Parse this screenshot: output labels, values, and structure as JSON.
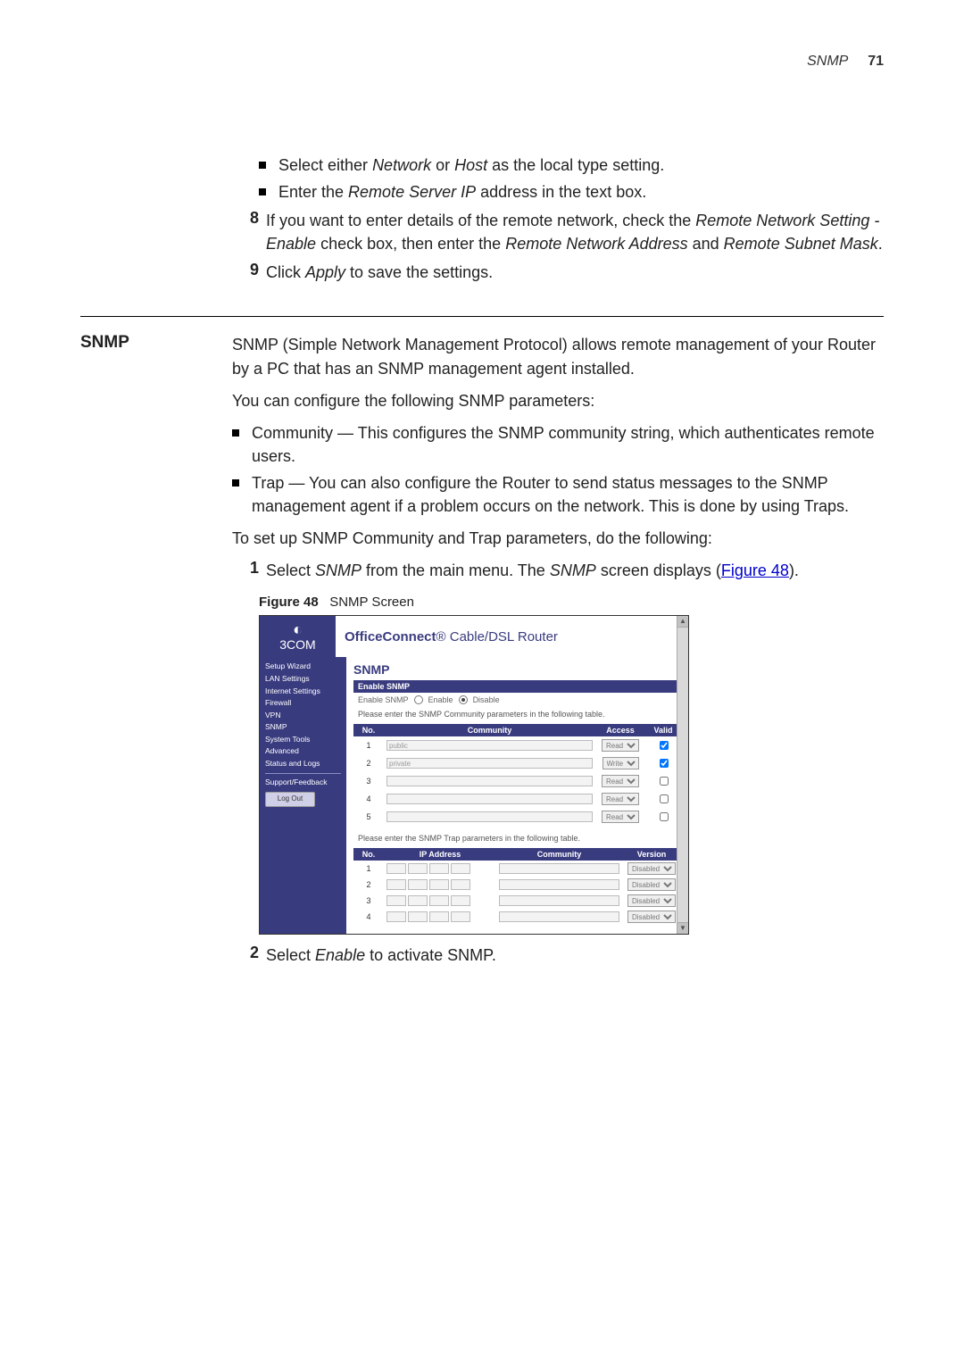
{
  "header": {
    "section": "SNMP",
    "page": "71"
  },
  "top_bullets": [
    {
      "pre": "Select either ",
      "i1": "Network",
      "mid": " or ",
      "i2": "Host",
      "post": " as the local type setting."
    },
    {
      "pre": "Enter the ",
      "i1": "Remote Server IP",
      "post": " address in the text box."
    }
  ],
  "steps_a": [
    {
      "n": "8",
      "pre": "If you want to enter details of the remote network, check the ",
      "i1": "Remote Network Setting - Enable",
      "mid": " check box, then enter the ",
      "i2": "Remote Network Address",
      "mid2": " and ",
      "i3": "Remote Subnet Mask",
      "post": "."
    },
    {
      "n": "9",
      "pre": "Click ",
      "i1": "Apply",
      "post": " to save the settings."
    }
  ],
  "sect_label": "SNMP",
  "snmp_intro": "SNMP (Simple Network Management Protocol) allows remote management of your Router by a PC that has an SNMP management agent installed.",
  "snmp_conf": "You can configure the following SNMP parameters:",
  "snmp_bullets": [
    "Community — This configures the SNMP community string, which authenticates remote users.",
    "Trap — You can also configure the Router to send status messages to the SNMP management agent if a problem occurs on the network. This is done by using Traps."
  ],
  "snmp_setup": "To set up SNMP Community and Trap parameters, do the following:",
  "steps_b": [
    {
      "n": "1",
      "pre": "Select ",
      "i1": "SNMP",
      "mid": " from the main menu. The ",
      "i2": "SNMP",
      "post": " screen displays (",
      "link": "Figure 48",
      "tail": ")."
    }
  ],
  "fig": {
    "label": "Figure 48",
    "caption": "SNMP Screen"
  },
  "steps_c": [
    {
      "n": "2",
      "pre": "Select ",
      "i1": "Enable",
      "post": " to activate SNMP."
    }
  ],
  "shot": {
    "brand": "3COM",
    "title_bold": "OfficeConnect",
    "title_rest": "® Cable/DSL Router",
    "nav": [
      "Setup Wizard",
      "LAN Settings",
      "Internet Settings",
      "Firewall",
      "VPN",
      "SNMP",
      "System Tools",
      "Advanced",
      "Status and Logs",
      "Support/Feedback"
    ],
    "logout": "Log Out",
    "h": "SNMP",
    "enable_bar": "Enable SNMP",
    "enable_row": {
      "lbl": "Enable SNMP",
      "opt1": "Enable",
      "opt2": "Disable"
    },
    "comm_caption": "Please enter the SNMP Community parameters in the following table.",
    "comm_headers": [
      "No.",
      "Community",
      "Access",
      "Valid"
    ],
    "comm_rows": [
      {
        "n": "1",
        "c": "public",
        "a": "Read",
        "v": true
      },
      {
        "n": "2",
        "c": "private",
        "a": "Write",
        "v": true
      },
      {
        "n": "3",
        "c": "",
        "a": "Read",
        "v": false
      },
      {
        "n": "4",
        "c": "",
        "a": "Read",
        "v": false
      },
      {
        "n": "5",
        "c": "",
        "a": "Read",
        "v": false
      }
    ],
    "trap_caption": "Please enter the SNMP Trap parameters in the following table.",
    "trap_headers": [
      "No.",
      "IP Address",
      "Community",
      "Version"
    ],
    "trap_rows": [
      {
        "n": "1",
        "v": "Disabled"
      },
      {
        "n": "2",
        "v": "Disabled"
      },
      {
        "n": "3",
        "v": "Disabled"
      },
      {
        "n": "4",
        "v": "Disabled"
      }
    ]
  }
}
